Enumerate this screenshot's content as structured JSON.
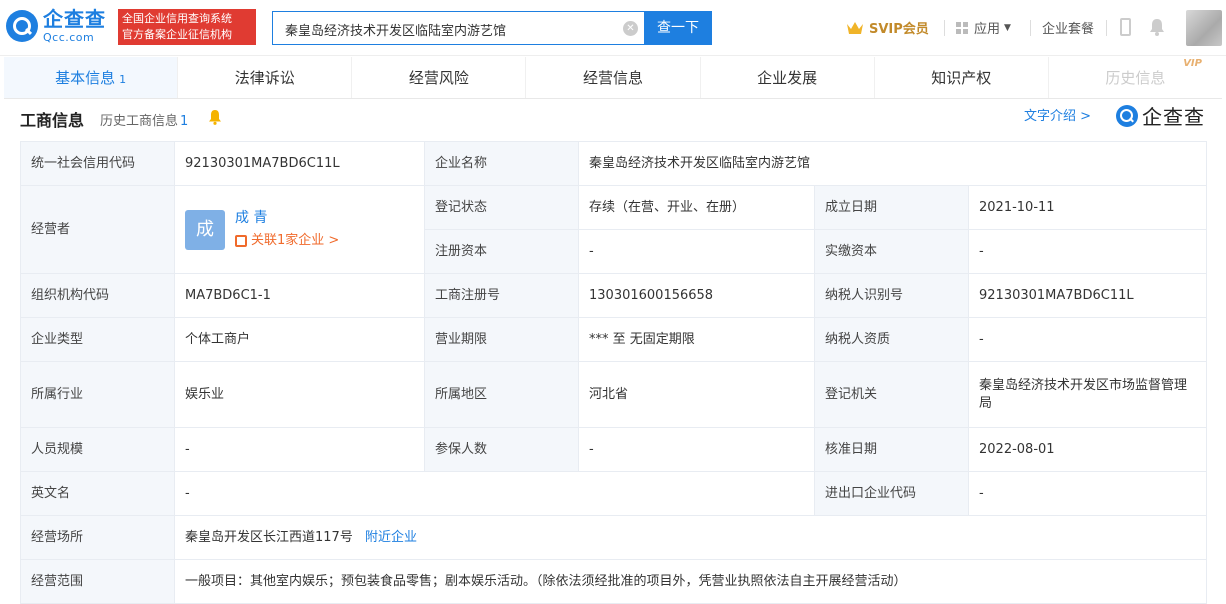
{
  "header": {
    "logo_cn": "企查查",
    "logo_en": "Qcc.com",
    "badge_line1": "全国企业信用查询系统",
    "badge_line2": "官方备案企业征信机构",
    "search_value": "秦皇岛经济技术开发区临陆室内游艺馆",
    "search_button": "查一下",
    "svip": "SVIP会员",
    "apps": "应用",
    "enterprise_package": "企业套餐"
  },
  "tabs": [
    {
      "label": "基本信息",
      "count": "1"
    },
    {
      "label": "法律诉讼"
    },
    {
      "label": "经营风险"
    },
    {
      "label": "经营信息"
    },
    {
      "label": "企业发展"
    },
    {
      "label": "知识产权"
    },
    {
      "label": "历史信息",
      "badge": "VIP"
    }
  ],
  "section": {
    "title": "工商信息",
    "history_label": "历史工商信息",
    "history_count": "1",
    "text_intro": "文字介绍 >",
    "brand": "企查查"
  },
  "info": {
    "credit_code_label": "统一社会信用代码",
    "credit_code": "92130301MA7BD6C11L",
    "company_name_label": "企业名称",
    "company_name": "秦皇岛经济技术开发区临陆室内游艺馆",
    "operator_label": "经营者",
    "operator_avatar": "成",
    "operator_name": "成 青",
    "operator_related": "关联1家企业 >",
    "reg_status_label": "登记状态",
    "reg_status": "存续（在营、开业、在册）",
    "founded_label": "成立日期",
    "founded": "2021-10-11",
    "reg_capital_label": "注册资本",
    "reg_capital": "-",
    "paid_capital_label": "实缴资本",
    "paid_capital": "-",
    "org_code_label": "组织机构代码",
    "org_code": "MA7BD6C1-1",
    "biz_reg_no_label": "工商注册号",
    "biz_reg_no": "130301600156658",
    "taxpayer_id_label": "纳税人识别号",
    "taxpayer_id": "92130301MA7BD6C11L",
    "company_type_label": "企业类型",
    "company_type": "个体工商户",
    "biz_term_label": "营业期限",
    "biz_term": "*** 至 无固定期限",
    "taxpayer_qual_label": "纳税人资质",
    "taxpayer_qual": "-",
    "industry_label": "所属行业",
    "industry": "娱乐业",
    "region_label": "所属地区",
    "region": "河北省",
    "reg_authority_label": "登记机关",
    "reg_authority": "秦皇岛经济技术开发区市场监督管理局",
    "staff_size_label": "人员规模",
    "staff_size": "-",
    "insured_label": "参保人数",
    "insured": "-",
    "approval_date_label": "核准日期",
    "approval_date": "2022-08-01",
    "english_name_label": "英文名",
    "english_name": "-",
    "import_export_label": "进出口企业代码",
    "import_export": "-",
    "address_label": "经营场所",
    "address": "秦皇岛开发区长江西道117号",
    "nearby": "附近企业",
    "scope_label": "经营范围",
    "scope": "一般项目：其他室内娱乐；预包装食品零售；剧本娱乐活动。（除依法须经批准的项目外，凭营业执照依法自主开展经营活动）"
  },
  "colors": {
    "brand_blue": "#1e7fe0",
    "badge_red": "#e03b32",
    "vip_gold": "#c28a2a",
    "relation_orange": "#f06a2b"
  }
}
